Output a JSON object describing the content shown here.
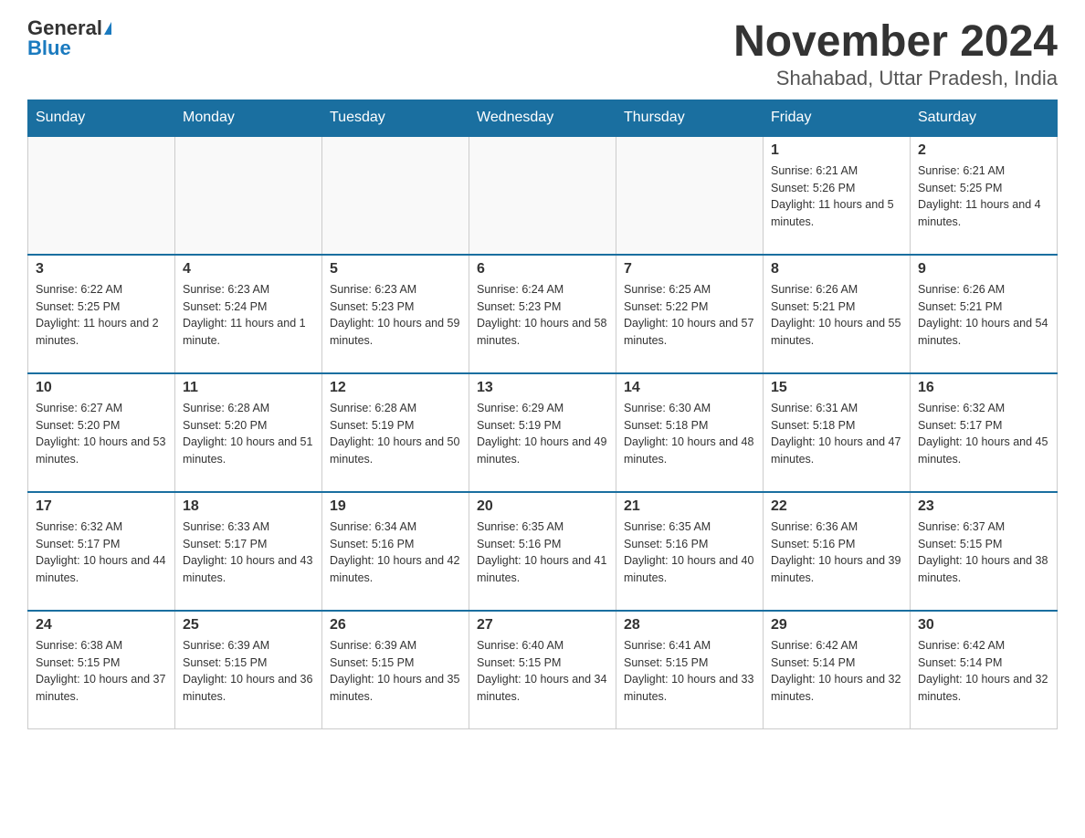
{
  "header": {
    "logo_general": "General",
    "logo_blue": "Blue",
    "month_year": "November 2024",
    "location": "Shahabad, Uttar Pradesh, India"
  },
  "weekdays": [
    "Sunday",
    "Monday",
    "Tuesday",
    "Wednesday",
    "Thursday",
    "Friday",
    "Saturday"
  ],
  "weeks": [
    [
      {
        "day": "",
        "sunrise": "",
        "sunset": "",
        "daylight": ""
      },
      {
        "day": "",
        "sunrise": "",
        "sunset": "",
        "daylight": ""
      },
      {
        "day": "",
        "sunrise": "",
        "sunset": "",
        "daylight": ""
      },
      {
        "day": "",
        "sunrise": "",
        "sunset": "",
        "daylight": ""
      },
      {
        "day": "",
        "sunrise": "",
        "sunset": "",
        "daylight": ""
      },
      {
        "day": "1",
        "sunrise": "Sunrise: 6:21 AM",
        "sunset": "Sunset: 5:26 PM",
        "daylight": "Daylight: 11 hours and 5 minutes."
      },
      {
        "day": "2",
        "sunrise": "Sunrise: 6:21 AM",
        "sunset": "Sunset: 5:25 PM",
        "daylight": "Daylight: 11 hours and 4 minutes."
      }
    ],
    [
      {
        "day": "3",
        "sunrise": "Sunrise: 6:22 AM",
        "sunset": "Sunset: 5:25 PM",
        "daylight": "Daylight: 11 hours and 2 minutes."
      },
      {
        "day": "4",
        "sunrise": "Sunrise: 6:23 AM",
        "sunset": "Sunset: 5:24 PM",
        "daylight": "Daylight: 11 hours and 1 minute."
      },
      {
        "day": "5",
        "sunrise": "Sunrise: 6:23 AM",
        "sunset": "Sunset: 5:23 PM",
        "daylight": "Daylight: 10 hours and 59 minutes."
      },
      {
        "day": "6",
        "sunrise": "Sunrise: 6:24 AM",
        "sunset": "Sunset: 5:23 PM",
        "daylight": "Daylight: 10 hours and 58 minutes."
      },
      {
        "day": "7",
        "sunrise": "Sunrise: 6:25 AM",
        "sunset": "Sunset: 5:22 PM",
        "daylight": "Daylight: 10 hours and 57 minutes."
      },
      {
        "day": "8",
        "sunrise": "Sunrise: 6:26 AM",
        "sunset": "Sunset: 5:21 PM",
        "daylight": "Daylight: 10 hours and 55 minutes."
      },
      {
        "day": "9",
        "sunrise": "Sunrise: 6:26 AM",
        "sunset": "Sunset: 5:21 PM",
        "daylight": "Daylight: 10 hours and 54 minutes."
      }
    ],
    [
      {
        "day": "10",
        "sunrise": "Sunrise: 6:27 AM",
        "sunset": "Sunset: 5:20 PM",
        "daylight": "Daylight: 10 hours and 53 minutes."
      },
      {
        "day": "11",
        "sunrise": "Sunrise: 6:28 AM",
        "sunset": "Sunset: 5:20 PM",
        "daylight": "Daylight: 10 hours and 51 minutes."
      },
      {
        "day": "12",
        "sunrise": "Sunrise: 6:28 AM",
        "sunset": "Sunset: 5:19 PM",
        "daylight": "Daylight: 10 hours and 50 minutes."
      },
      {
        "day": "13",
        "sunrise": "Sunrise: 6:29 AM",
        "sunset": "Sunset: 5:19 PM",
        "daylight": "Daylight: 10 hours and 49 minutes."
      },
      {
        "day": "14",
        "sunrise": "Sunrise: 6:30 AM",
        "sunset": "Sunset: 5:18 PM",
        "daylight": "Daylight: 10 hours and 48 minutes."
      },
      {
        "day": "15",
        "sunrise": "Sunrise: 6:31 AM",
        "sunset": "Sunset: 5:18 PM",
        "daylight": "Daylight: 10 hours and 47 minutes."
      },
      {
        "day": "16",
        "sunrise": "Sunrise: 6:32 AM",
        "sunset": "Sunset: 5:17 PM",
        "daylight": "Daylight: 10 hours and 45 minutes."
      }
    ],
    [
      {
        "day": "17",
        "sunrise": "Sunrise: 6:32 AM",
        "sunset": "Sunset: 5:17 PM",
        "daylight": "Daylight: 10 hours and 44 minutes."
      },
      {
        "day": "18",
        "sunrise": "Sunrise: 6:33 AM",
        "sunset": "Sunset: 5:17 PM",
        "daylight": "Daylight: 10 hours and 43 minutes."
      },
      {
        "day": "19",
        "sunrise": "Sunrise: 6:34 AM",
        "sunset": "Sunset: 5:16 PM",
        "daylight": "Daylight: 10 hours and 42 minutes."
      },
      {
        "day": "20",
        "sunrise": "Sunrise: 6:35 AM",
        "sunset": "Sunset: 5:16 PM",
        "daylight": "Daylight: 10 hours and 41 minutes."
      },
      {
        "day": "21",
        "sunrise": "Sunrise: 6:35 AM",
        "sunset": "Sunset: 5:16 PM",
        "daylight": "Daylight: 10 hours and 40 minutes."
      },
      {
        "day": "22",
        "sunrise": "Sunrise: 6:36 AM",
        "sunset": "Sunset: 5:16 PM",
        "daylight": "Daylight: 10 hours and 39 minutes."
      },
      {
        "day": "23",
        "sunrise": "Sunrise: 6:37 AM",
        "sunset": "Sunset: 5:15 PM",
        "daylight": "Daylight: 10 hours and 38 minutes."
      }
    ],
    [
      {
        "day": "24",
        "sunrise": "Sunrise: 6:38 AM",
        "sunset": "Sunset: 5:15 PM",
        "daylight": "Daylight: 10 hours and 37 minutes."
      },
      {
        "day": "25",
        "sunrise": "Sunrise: 6:39 AM",
        "sunset": "Sunset: 5:15 PM",
        "daylight": "Daylight: 10 hours and 36 minutes."
      },
      {
        "day": "26",
        "sunrise": "Sunrise: 6:39 AM",
        "sunset": "Sunset: 5:15 PM",
        "daylight": "Daylight: 10 hours and 35 minutes."
      },
      {
        "day": "27",
        "sunrise": "Sunrise: 6:40 AM",
        "sunset": "Sunset: 5:15 PM",
        "daylight": "Daylight: 10 hours and 34 minutes."
      },
      {
        "day": "28",
        "sunrise": "Sunrise: 6:41 AM",
        "sunset": "Sunset: 5:15 PM",
        "daylight": "Daylight: 10 hours and 33 minutes."
      },
      {
        "day": "29",
        "sunrise": "Sunrise: 6:42 AM",
        "sunset": "Sunset: 5:14 PM",
        "daylight": "Daylight: 10 hours and 32 minutes."
      },
      {
        "day": "30",
        "sunrise": "Sunrise: 6:42 AM",
        "sunset": "Sunset: 5:14 PM",
        "daylight": "Daylight: 10 hours and 32 minutes."
      }
    ]
  ]
}
